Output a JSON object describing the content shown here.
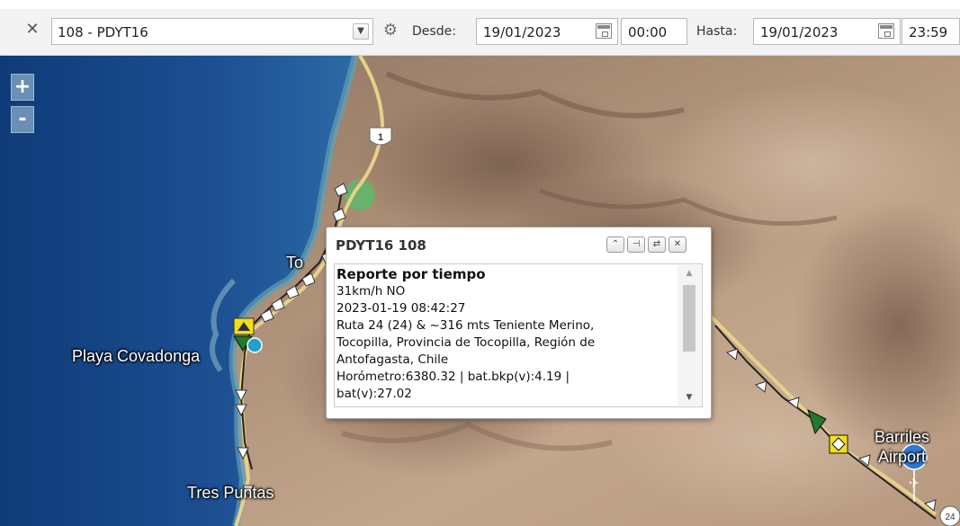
{
  "toolbar": {
    "close_icon": "close-icon",
    "vehicle_select": {
      "value": "108 - PDYT16",
      "icon": "chevron-down-icon"
    },
    "settings_icon": "gear-icon",
    "from_label": "Desde:",
    "from_date": "19/01/2023",
    "from_time": "00:00",
    "to_label": "Hasta:",
    "to_date": "19/01/2023",
    "to_time": "23:59",
    "calendar_icon": "calendar-icon"
  },
  "map": {
    "zoom_in": "+",
    "zoom_out": "-",
    "labels": {
      "town_partial": "To",
      "beach": "Playa Covadonga",
      "tres_puntas": "Tres Puntas",
      "airport_line1": "Barriles",
      "airport_line2": "Airport"
    },
    "route_shields": [
      "1",
      "24"
    ],
    "colors": {
      "sea": "#1f4f8f",
      "desert": "#b79a80",
      "route": "#ffffff",
      "track_line": "#333333",
      "marker_green": "#1f7a2a",
      "marker_yellow": "#f2df1a"
    }
  },
  "popup": {
    "title": "PDYT16 108",
    "buttons": [
      "collapse-icon",
      "pin-icon",
      "refresh-icon",
      "close-icon"
    ],
    "lines": {
      "heading": "Reporte por tiempo",
      "speed": "31km/h NO",
      "datetime": "2023-01-19 08:42:27",
      "address1": "Ruta 24 (24) & ~316 mts Teniente Merino,",
      "address2": "Tocopilla, Provincia de Tocopilla, Región de",
      "address3": "Antofagasta, Chile",
      "telemetry": "Horómetro:6380.32 | bat.bkp(v):4.19 |",
      "telemetry_cut": "bat(v):27.02"
    }
  }
}
